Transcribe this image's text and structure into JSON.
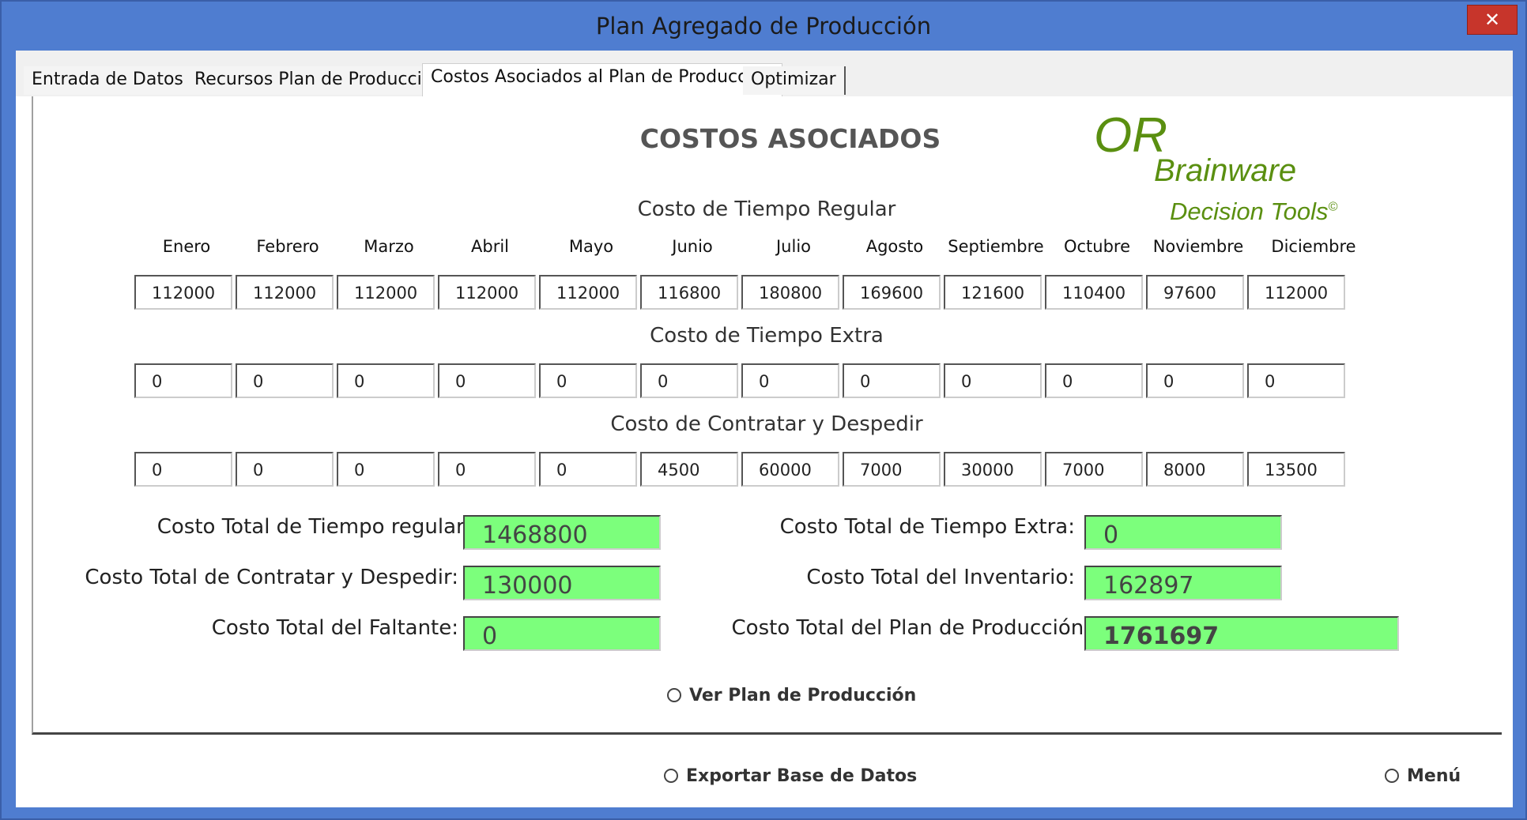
{
  "window": {
    "title": "Plan Agregado de Producción",
    "close_label": "✕"
  },
  "tabs": [
    {
      "label": "Entrada de Datos"
    },
    {
      "label": "Recursos Plan de Producción"
    },
    {
      "label": "Costos Asociados al Plan de Producción"
    },
    {
      "label": "Optimizar"
    }
  ],
  "heading": "COSTOS ASOCIADOS",
  "logo": {
    "or": "OR",
    "brainware": "Brainware",
    "decision": "Decision Tools",
    "copyright": "©"
  },
  "months": [
    "Enero",
    "Febrero",
    "Marzo",
    "Abril",
    "Mayo",
    "Junio",
    "Julio",
    "Agosto",
    "Septiembre",
    "Octubre",
    "Noviembre",
    "Diciembre"
  ],
  "regular": {
    "title": "Costo de Tiempo Regular",
    "values": [
      "112000",
      "112000",
      "112000",
      "112000",
      "112000",
      "116800",
      "180800",
      "169600",
      "121600",
      "110400",
      "97600",
      "112000"
    ]
  },
  "extra": {
    "title": "Costo de Tiempo Extra",
    "values": [
      "0",
      "0",
      "0",
      "0",
      "0",
      "0",
      "0",
      "0",
      "0",
      "0",
      "0",
      "0"
    ]
  },
  "hire": {
    "title": "Costo de Contratar y Despedir",
    "values": [
      "0",
      "0",
      "0",
      "0",
      "0",
      "4500",
      "60000",
      "7000",
      "30000",
      "7000",
      "8000",
      "13500"
    ]
  },
  "totals": {
    "regular_label": "Costo Total de Tiempo regular:",
    "regular_value": "1468800",
    "extra_label": "Costo Total de Tiempo Extra:",
    "extra_value": "0",
    "hire_label": "Costo Total de Contratar y Despedir:",
    "hire_value": "130000",
    "inventory_label": "Costo Total del Inventario:",
    "inventory_value": "162897",
    "shortage_label": "Costo Total del Faltante:",
    "shortage_value": "0",
    "plan_label": "Costo Total del Plan de Producción:",
    "plan_value": "1761697"
  },
  "options": {
    "ver_plan": "Ver Plan de Producción",
    "exportar": "Exportar Base de Datos",
    "menu": "Menú"
  },
  "colors": {
    "titlebar": "#4f7dd0",
    "close": "#c7352b",
    "total_box": "#7cff7c",
    "logo": "#5a8f10"
  }
}
